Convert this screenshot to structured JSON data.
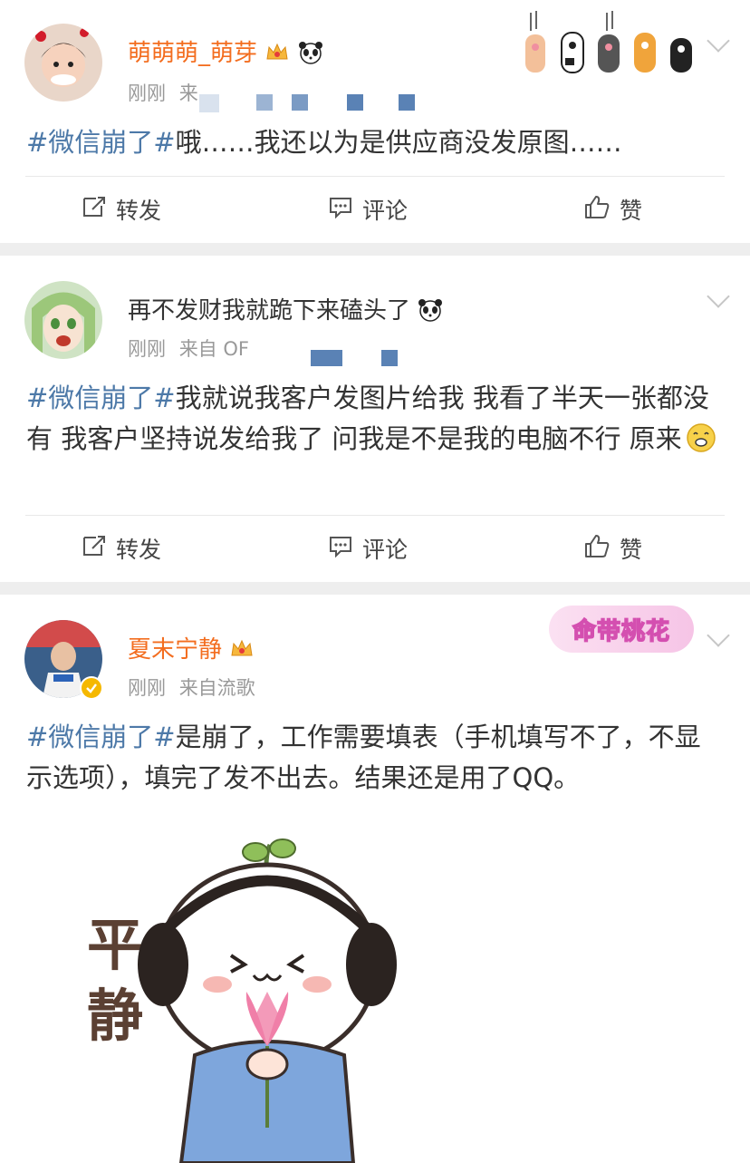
{
  "posts": [
    {
      "username": "萌萌萌_萌芽",
      "time": "刚刚",
      "source": "来",
      "hashtag": "#微信崩了#",
      "text": "哦……我还以为是供应商没发原图……",
      "actions": {
        "repost": "转发",
        "comment": "评论",
        "like": "赞"
      }
    },
    {
      "username": "再不发财我就跪下来磕头了",
      "time": "刚刚",
      "source": "来自 OF",
      "hashtag": "#微信崩了#",
      "text": "我就说我客户发图片给我 我看了半天一张都没有 我客户坚持说发给我了 问我是不是我的电脑不行 原来",
      "actions": {
        "repost": "转发",
        "comment": "评论",
        "like": "赞"
      }
    },
    {
      "username": "夏末宁静",
      "time": "刚刚",
      "source": "来自流歌",
      "hashtag": "#微信崩了#",
      "text": "是崩了，工作需要填表（手机填写不了，不显示选项），填完了发不出去。结果还是用了QQ。",
      "badge_text": "命带桃花",
      "sticker_text": [
        "平",
        "静"
      ],
      "actions": null
    }
  ],
  "icons": {
    "crown": "crown-icon",
    "panda": "panda-emoji-icon",
    "repost": "repost-icon",
    "comment": "comment-icon",
    "like": "thumbs-up-icon",
    "chevron": "chevron-down-icon"
  },
  "colors": {
    "vip_name": "#f36d1f",
    "hashtag": "#4d79a8",
    "meta": "#999999",
    "separator": "#eeeeee"
  }
}
